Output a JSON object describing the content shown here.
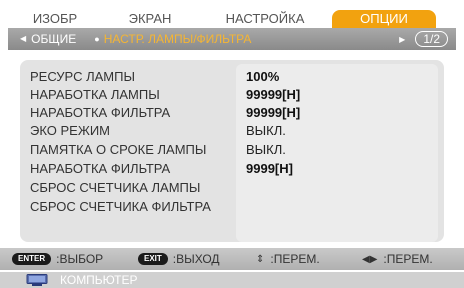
{
  "tabs": [
    {
      "label": "ИЗОБР",
      "active": false
    },
    {
      "label": "ЭКРАН",
      "active": false
    },
    {
      "label": "НАСТРОЙКА",
      "active": false
    },
    {
      "label": "ОПЦИИ",
      "active": true
    }
  ],
  "subheader": {
    "left_item": "ОБЩИЕ",
    "active_item": "НАСТР. ЛАМПЫ/ФИЛЬТРА",
    "page": "1/2"
  },
  "settings": [
    {
      "label": "РЕСУРС ЛАМПЫ",
      "value": "100%",
      "bold": true
    },
    {
      "label": "НАРАБОТКА ЛАМПЫ",
      "value": "99999[H]",
      "bold": true
    },
    {
      "label": "НАРАБОТКА ФИЛЬТРА",
      "value": "99999[H]",
      "bold": true
    },
    {
      "label": "ЭКО РЕЖИМ",
      "value": "ВЫКЛ.",
      "bold": false
    },
    {
      "label": "ПАМЯТКА О СРОКЕ ЛАМПЫ",
      "value": "ВЫКЛ.",
      "bold": false
    },
    {
      "label": "НАРАБОТКА ФИЛЬТРА",
      "value": "9999[H]",
      "bold": true
    },
    {
      "label": "СБРОС СЧЕТЧИКА ЛАМПЫ",
      "value": "",
      "bold": false
    },
    {
      "label": "СБРОС СЧЕТЧИКА ФИЛЬТРА",
      "value": "",
      "bold": false
    }
  ],
  "controls": {
    "enter_key": "ENTER",
    "enter_label": ":ВЫБОР",
    "exit_key": "EXIT",
    "exit_label": ":ВЫХОД",
    "updown_label": ":ПЕРЕМ.",
    "leftright_label": ":ПЕРЕМ."
  },
  "source": {
    "label": "КОМПЬЮТЕР",
    "icon": "monitor-icon"
  },
  "colors": {
    "accent": "#f2a20f",
    "subheader_bg": "#9b9b9b",
    "panel_bg": "#e3e3e3"
  }
}
